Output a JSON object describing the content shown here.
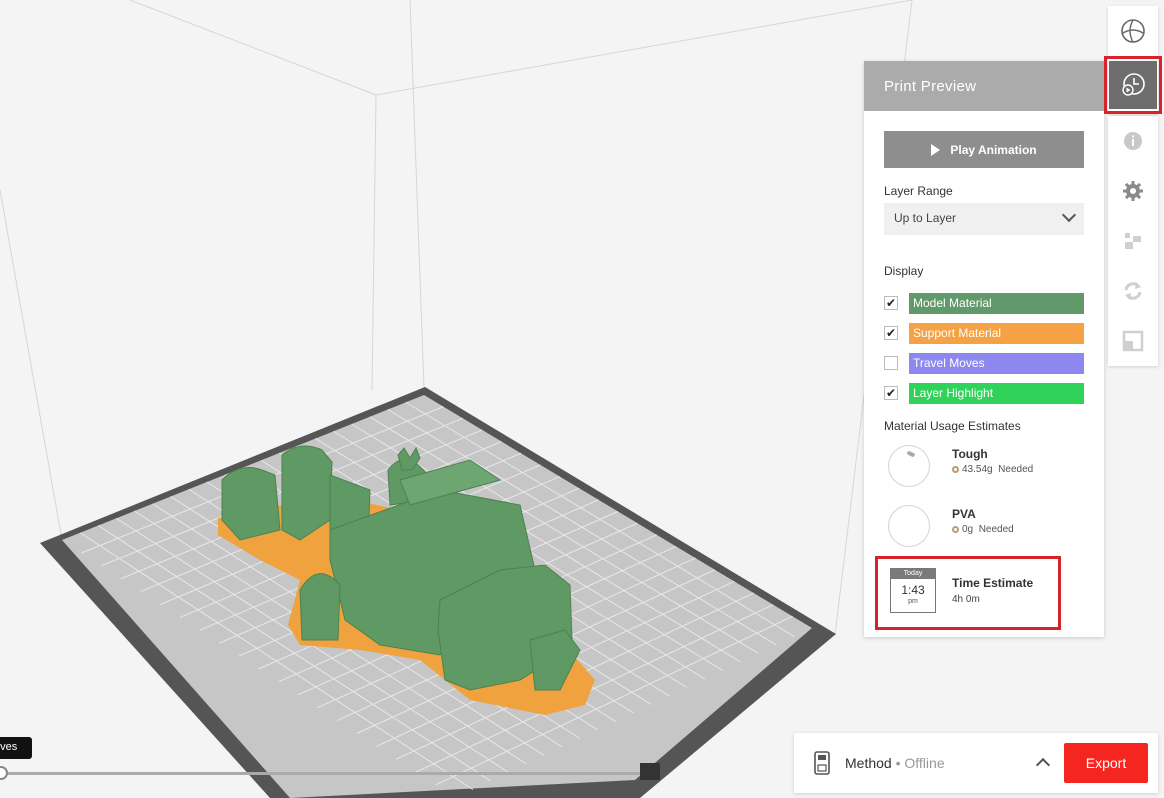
{
  "viewport": {
    "colors": {
      "background": "#f4f4f4",
      "plate": "#c6c6c6",
      "plate_frame": "#555555",
      "model": "#5f9963",
      "support": "#f0a23e"
    }
  },
  "print_preview": {
    "title": "Print Preview",
    "play_label": "Play Animation",
    "layer_range_label": "Layer Range",
    "layer_range_value": "Up to Layer",
    "display_label": "Display",
    "display_items": [
      {
        "label": "Model Material",
        "checked": true,
        "color": "#61996a"
      },
      {
        "label": "Support Material",
        "checked": true,
        "color": "#f5a245"
      },
      {
        "label": "Travel Moves",
        "checked": false,
        "color": "#8c88f0"
      },
      {
        "label": "Layer Highlight",
        "checked": true,
        "color": "#2fd35a"
      }
    ],
    "material_label": "Material Usage Estimates",
    "materials": [
      {
        "name": "Tough",
        "amount": "43.54g",
        "needed": "Needed"
      },
      {
        "name": "PVA",
        "amount": "0g",
        "needed": "Needed"
      }
    ],
    "time": {
      "cal_day": "Today",
      "cal_time": "1:43",
      "cal_ampm": "pm",
      "title": "Time Estimate",
      "value": "4h 0m"
    }
  },
  "right_rail": {
    "top": [
      "sphere-view-icon",
      "print-preview-icon"
    ],
    "tools": [
      "info-icon",
      "settings-gear-icon",
      "arrange-icon",
      "rotate-icon",
      "scale-icon"
    ],
    "active_color": "#6e6e6e",
    "highlight_color": "#d7232b"
  },
  "bottom_bar": {
    "printer_name": "Method",
    "separator": " • ",
    "printer_status": "Offline",
    "export_label": "Export",
    "export_color": "#f4261f"
  },
  "layer_slider": {
    "tooltip": "oves",
    "position_fraction": 0.0
  }
}
